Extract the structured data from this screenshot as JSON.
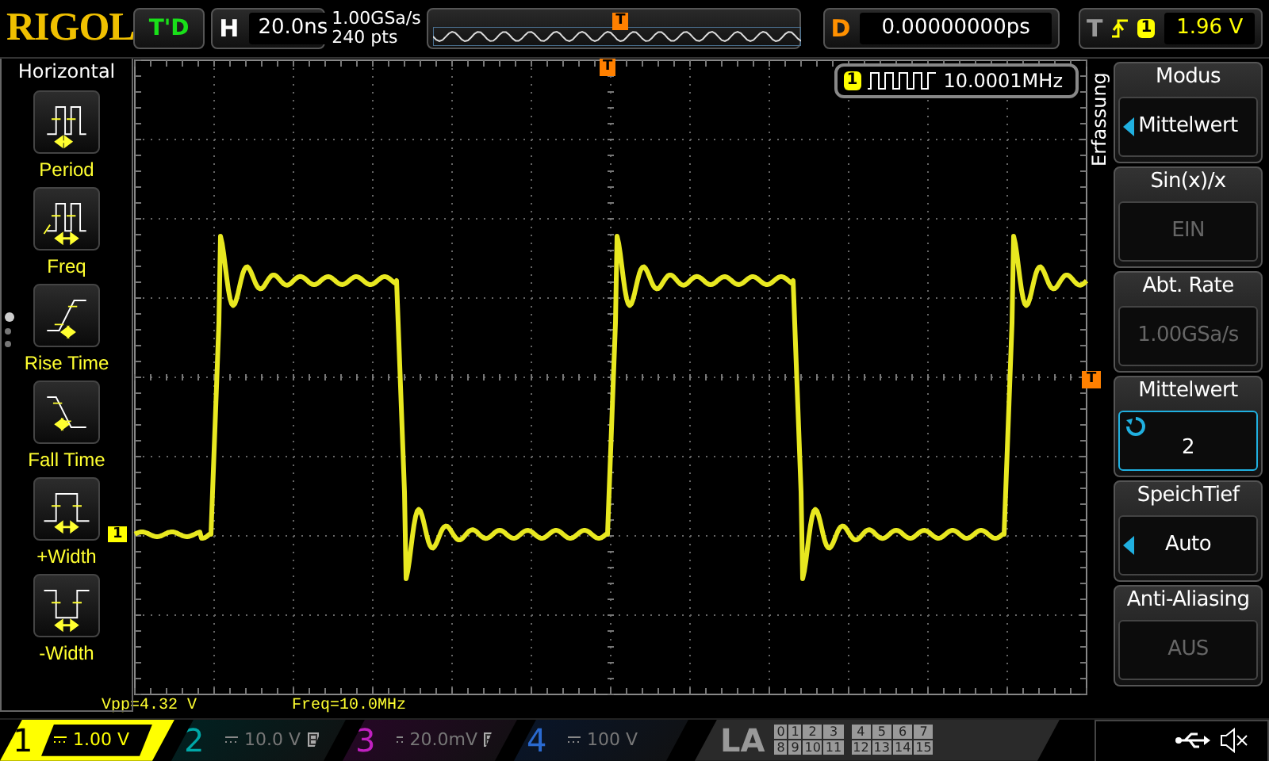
{
  "brand": "RIGOL",
  "run_status": "T'D",
  "timebase": {
    "label": "H",
    "value": "20.0ns"
  },
  "sampling": {
    "rate": "1.00GSa/s",
    "points": "240 pts"
  },
  "delay": {
    "label": "D",
    "value": "0.00000000ps"
  },
  "trigger": {
    "label": "T",
    "source": "1",
    "level": "1.96 V"
  },
  "left_menu": {
    "title": "Horizontal",
    "items": [
      {
        "label": "Period",
        "kind": "period"
      },
      {
        "label": "Freq",
        "kind": "freq"
      },
      {
        "label": "Rise Time",
        "kind": "rise"
      },
      {
        "label": "Fall Time",
        "kind": "fall"
      },
      {
        "label": "+Width",
        "kind": "pwidth"
      },
      {
        "label": "-Width",
        "kind": "nwidth"
      }
    ],
    "pages": [
      {
        "selected": true
      },
      {
        "selected": false
      },
      {
        "selected": false
      }
    ]
  },
  "frequency_counter": {
    "channel": "1",
    "value": "10.0001MHz"
  },
  "overview_marker": "T",
  "markers": {
    "trigger_position": "T",
    "channel": "1",
    "trigger_level": "T"
  },
  "measurements": [
    {
      "text": "Vpp=4.32 V"
    },
    {
      "text": "Freq=10.0MHz"
    }
  ],
  "right_menu": {
    "title": "Erfassung",
    "items": [
      {
        "label": "Modus",
        "value": "Mittelwert",
        "kind": "select",
        "focused": false
      },
      {
        "label": "Sin(x)/x",
        "value": "EIN",
        "kind": "readonly",
        "focused": false
      },
      {
        "label": "Abt. Rate",
        "value": "1.00GSa/s",
        "kind": "readonly",
        "focused": false
      },
      {
        "label": "Mittelwert",
        "value": "2",
        "kind": "knob",
        "focused": true
      },
      {
        "label": "SpeichTief",
        "value": "Auto",
        "kind": "select",
        "focused": false
      },
      {
        "label": "Anti-Aliasing",
        "value": "AUS",
        "kind": "readonly",
        "focused": false
      }
    ]
  },
  "channels": [
    {
      "number": "1",
      "scale": "1.00 V",
      "active": true,
      "bw_limit": false,
      "color": "#ffff00"
    },
    {
      "number": "2",
      "scale": "10.0 V",
      "active": false,
      "bw_limit": true,
      "color": "#00a8a8"
    },
    {
      "number": "3",
      "scale": "20.0mV",
      "active": false,
      "bw_limit": true,
      "color": "#c020c0"
    },
    {
      "number": "4",
      "scale": "100 V",
      "active": false,
      "bw_limit": false,
      "color": "#2a6ad0"
    }
  ],
  "logic_analyzer": {
    "label": "LA",
    "rows": [
      [
        "0",
        "1",
        "2",
        "3",
        "4",
        "5",
        "6",
        "7"
      ],
      [
        "8",
        "9",
        "10",
        "11",
        "12",
        "13",
        "14",
        "15"
      ]
    ]
  }
}
